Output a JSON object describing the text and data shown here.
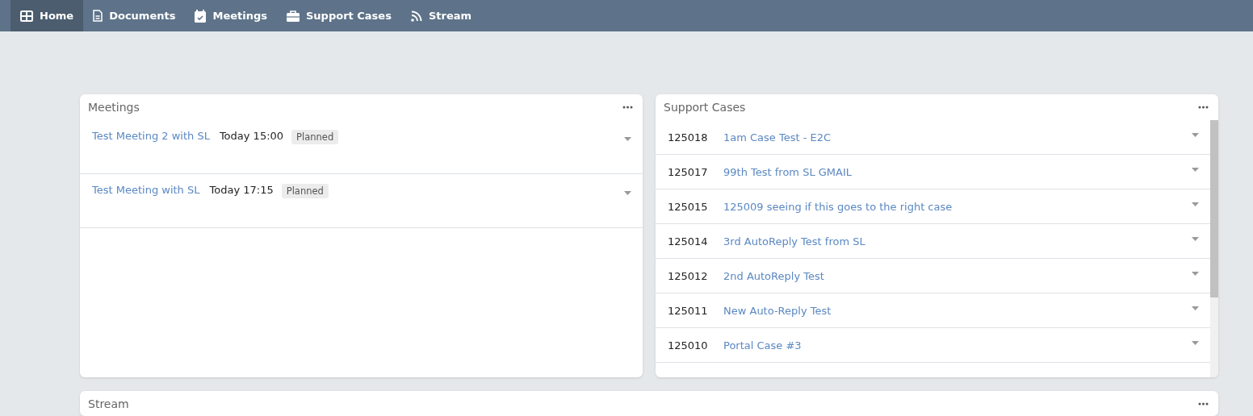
{
  "nav": {
    "items": [
      {
        "label": "Home",
        "selected": true
      },
      {
        "label": "Documents",
        "selected": false
      },
      {
        "label": "Meetings",
        "selected": false
      },
      {
        "label": "Support Cases",
        "selected": false
      },
      {
        "label": "Stream",
        "selected": false
      }
    ]
  },
  "meetings": {
    "title": "Meetings",
    "items": [
      {
        "name": "Test Meeting 2 with SL",
        "time": "Today 15:00",
        "status": "Planned"
      },
      {
        "name": "Test Meeting with SL",
        "time": "Today 17:15",
        "status": "Planned"
      }
    ]
  },
  "support_cases": {
    "title": "Support Cases",
    "items": [
      {
        "number": "125018",
        "subject": "1am Case Test - E2C"
      },
      {
        "number": "125017",
        "subject": "99th Test from SL GMAIL"
      },
      {
        "number": "125015",
        "subject": "125009 seeing if this goes to the right case"
      },
      {
        "number": "125014",
        "subject": "3rd AutoReply Test from SL"
      },
      {
        "number": "125012",
        "subject": "2nd AutoReply Test"
      },
      {
        "number": "125011",
        "subject": "New Auto-Reply Test"
      },
      {
        "number": "125010",
        "subject": "Portal Case #3"
      }
    ]
  },
  "stream": {
    "title": "Stream"
  }
}
